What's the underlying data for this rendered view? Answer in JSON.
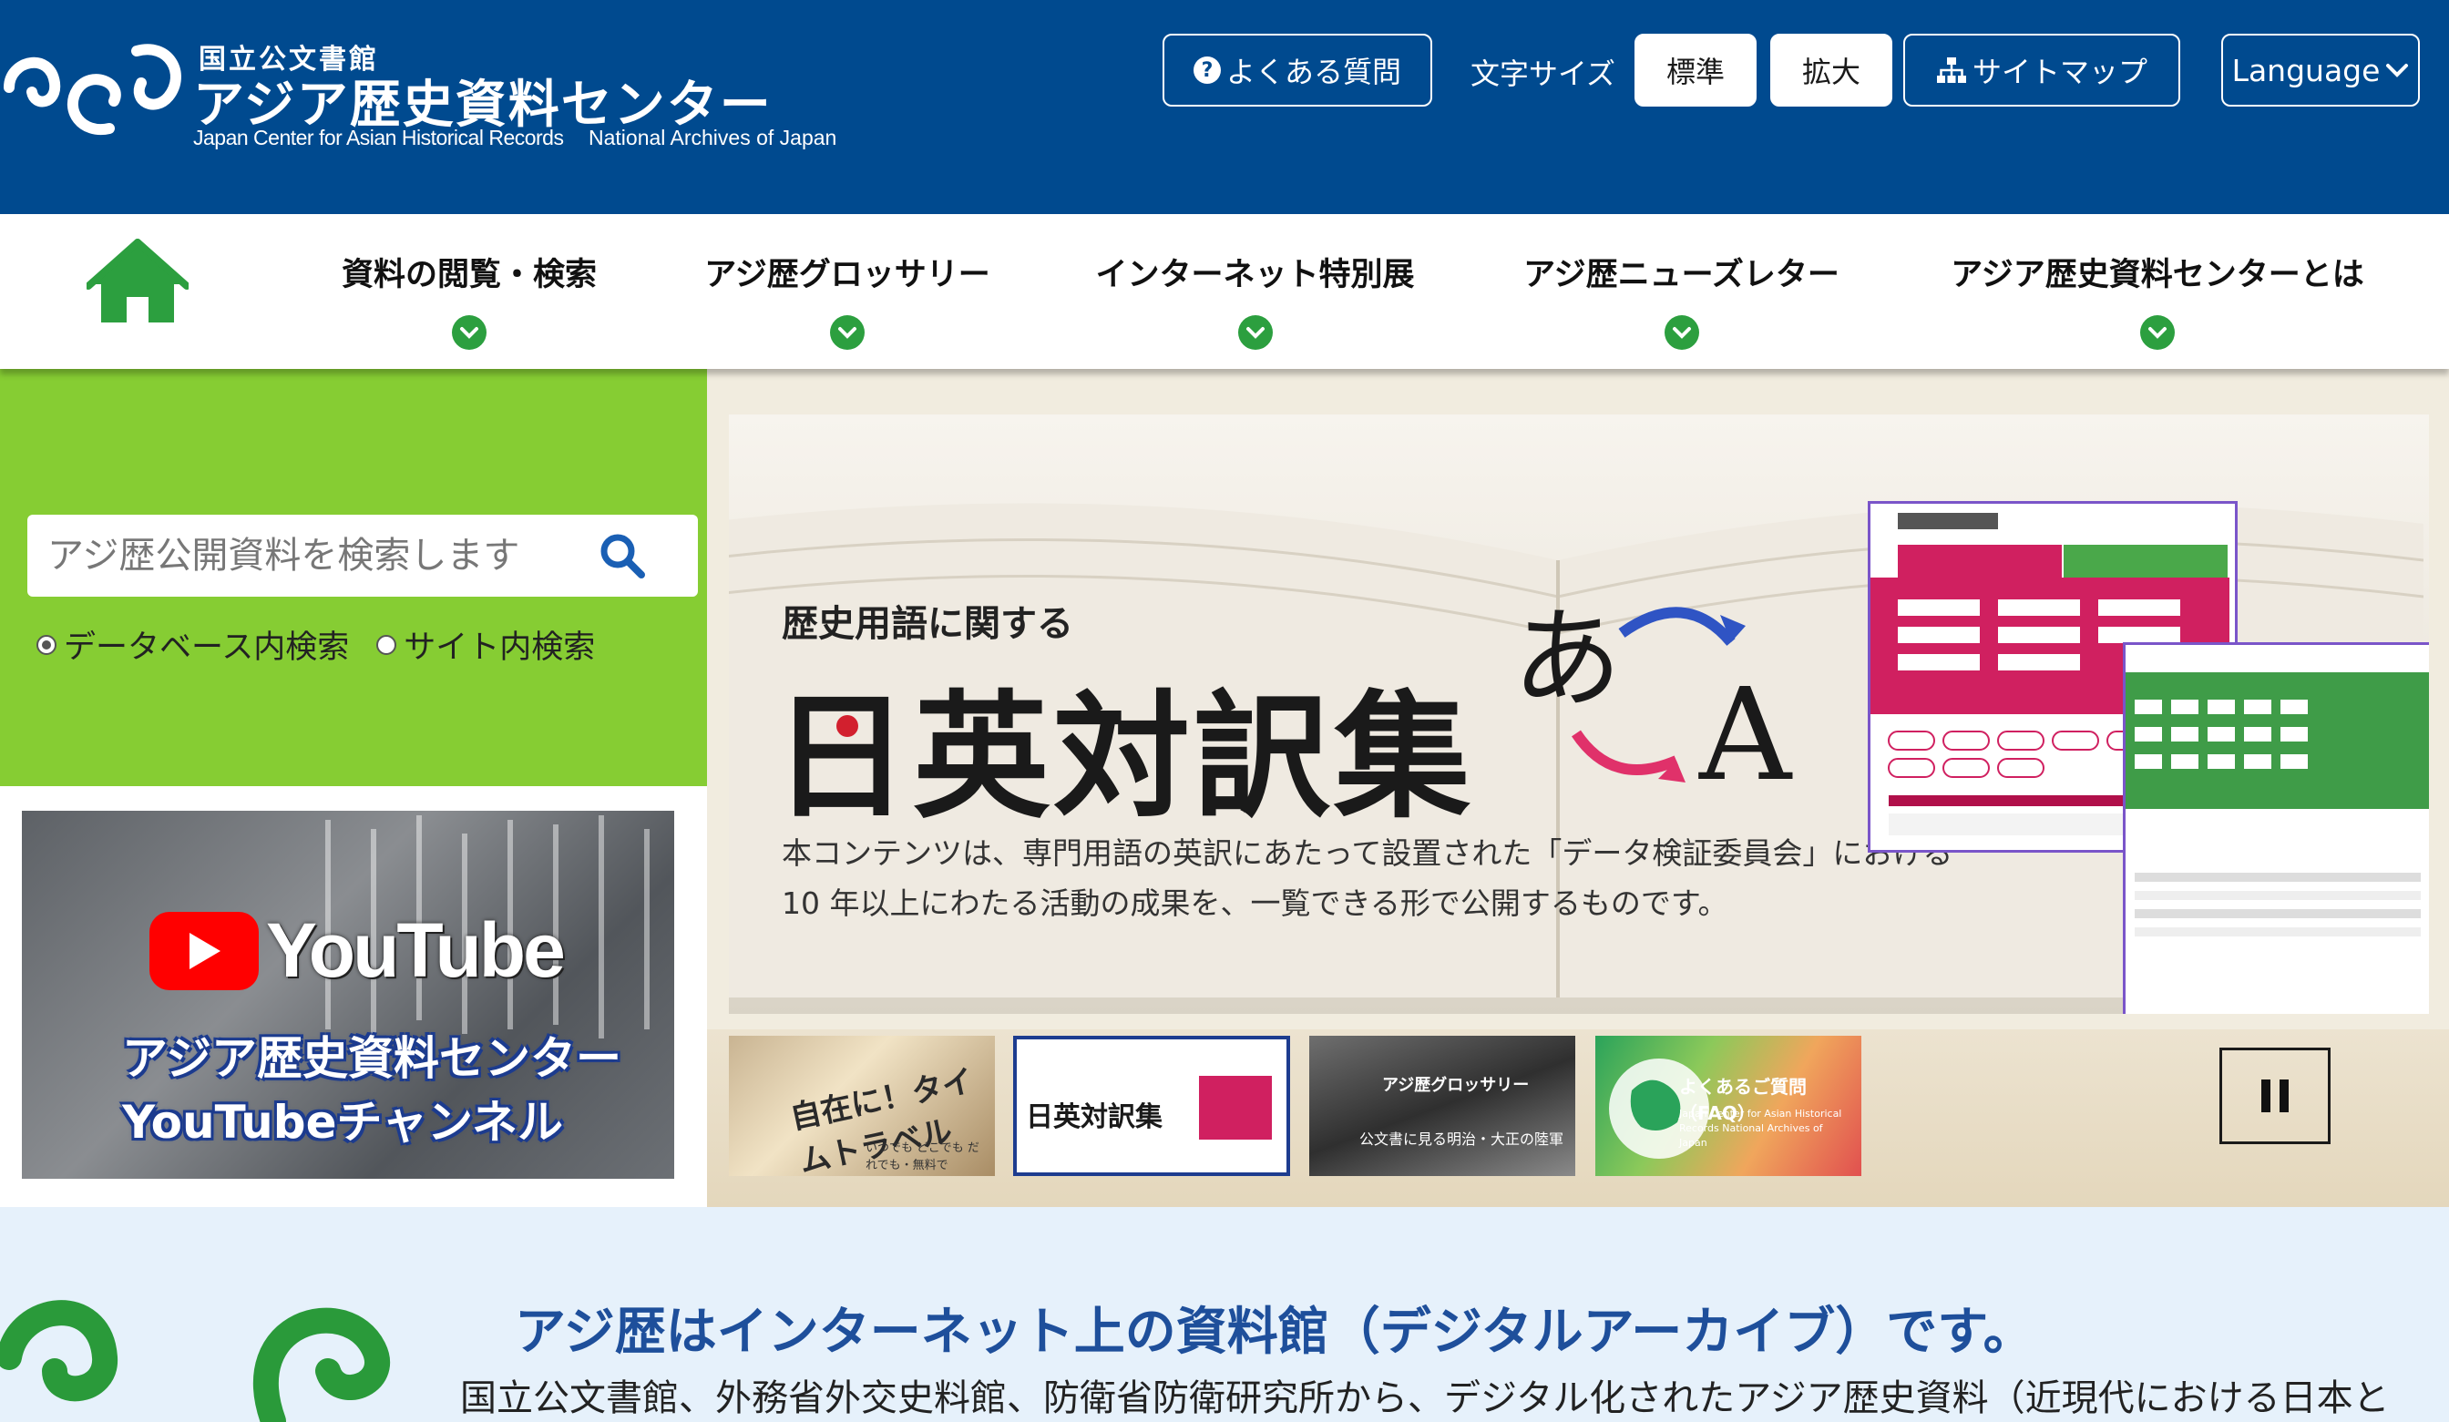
{
  "header": {
    "org_name": "国立公文書館",
    "site_name": "アジア歴史資料センター",
    "english_name": "Japan Center for Asian Historical Records",
    "english_org": "National Archives of Japan",
    "faq_label": "よくある質問",
    "font_size_label": "文字サイズ",
    "font_standard": "標準",
    "font_large": "拡大",
    "sitemap_label": "サイトマップ",
    "language_label": "Language"
  },
  "nav": {
    "items": [
      {
        "label": "資料の閲覧・検索"
      },
      {
        "label": "アジ歴グロッサリー"
      },
      {
        "label": "インターネット特別展"
      },
      {
        "label": "アジ歴ニューズレター"
      },
      {
        "label": "アジア歴史資料センターとは"
      }
    ]
  },
  "search": {
    "placeholder": "アジ歴公開資料を検索します",
    "option_db": "データベース内検索",
    "option_site": "サイト内検索",
    "selected": "データベース内検索"
  },
  "youtube": {
    "logo_text": "YouTube",
    "line1": "アジア歴史資料センター",
    "line2": "YouTubeチャンネル"
  },
  "slide": {
    "subtitle": "歴史用語に関する",
    "title": "日英対訳集",
    "jp_glyph": "あ",
    "en_glyph": "A",
    "desc_line1": "本コンテンツは、専門用語の英訳にあたって設置された「データ検証委員会」における",
    "desc_line2": "10 年以上にわたる活動の成果を、一覧できる形で公開するものです。"
  },
  "thumbnails": [
    {
      "label": "自在に！タイムトラベル",
      "caption": "いつでも どこでも だれでも・無料で"
    },
    {
      "label": "日英対訳集"
    },
    {
      "label": "アジ歴グロッサリー",
      "caption": "公文書に見る明治・大正の陸軍"
    },
    {
      "label": "よくあるご質問（FAQ）",
      "caption": "Japan Center for Asian Historical Records National Archives of Japan"
    }
  ],
  "intro": {
    "title": "アジ歴はインターネット上の資料館（デジタルアーカイブ）です。",
    "text": "国立公文書館、外務省外交史料館、防衛省防衛研究所から、デジタル化されたアジア歴史資料（近現代における日本と"
  },
  "colors": {
    "header_bg": "#004a8f",
    "nav_green": "#2c9f3f",
    "search_panel": "#86cd33",
    "intro_bg": "#e6f1fb",
    "intro_title": "#1e4f9b",
    "youtube_red": "#ff0000"
  },
  "icons": [
    "home-icon",
    "question-icon",
    "sitemap-icon",
    "chevron-down-icon",
    "search-icon",
    "pause-icon",
    "youtube-play-icon"
  ]
}
